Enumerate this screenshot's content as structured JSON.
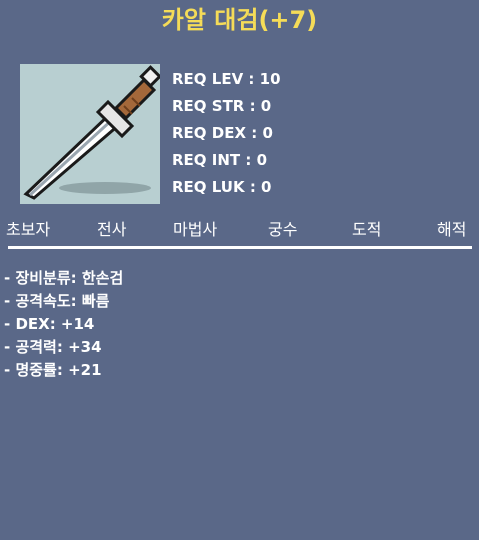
{
  "title": "카알 대검(+7)",
  "colors": {
    "background": "#5a6888",
    "title": "#f5dc58",
    "item_bg": "#b8cfd1"
  },
  "item": {
    "icon": "dagger-icon"
  },
  "requirements": [
    "REQ LEV : 10",
    "REQ STR : 0",
    "REQ DEX : 0",
    "REQ INT : 0",
    "REQ LUK : 0"
  ],
  "jobs": [
    "초보자",
    "전사",
    "마법사",
    "궁수",
    "도적",
    "해적"
  ],
  "stats": [
    "- 장비분류: 한손검",
    "- 공격속도: 빠름",
    "- DEX: +14",
    "- 공격력: +34",
    "- 명중률: +21"
  ]
}
